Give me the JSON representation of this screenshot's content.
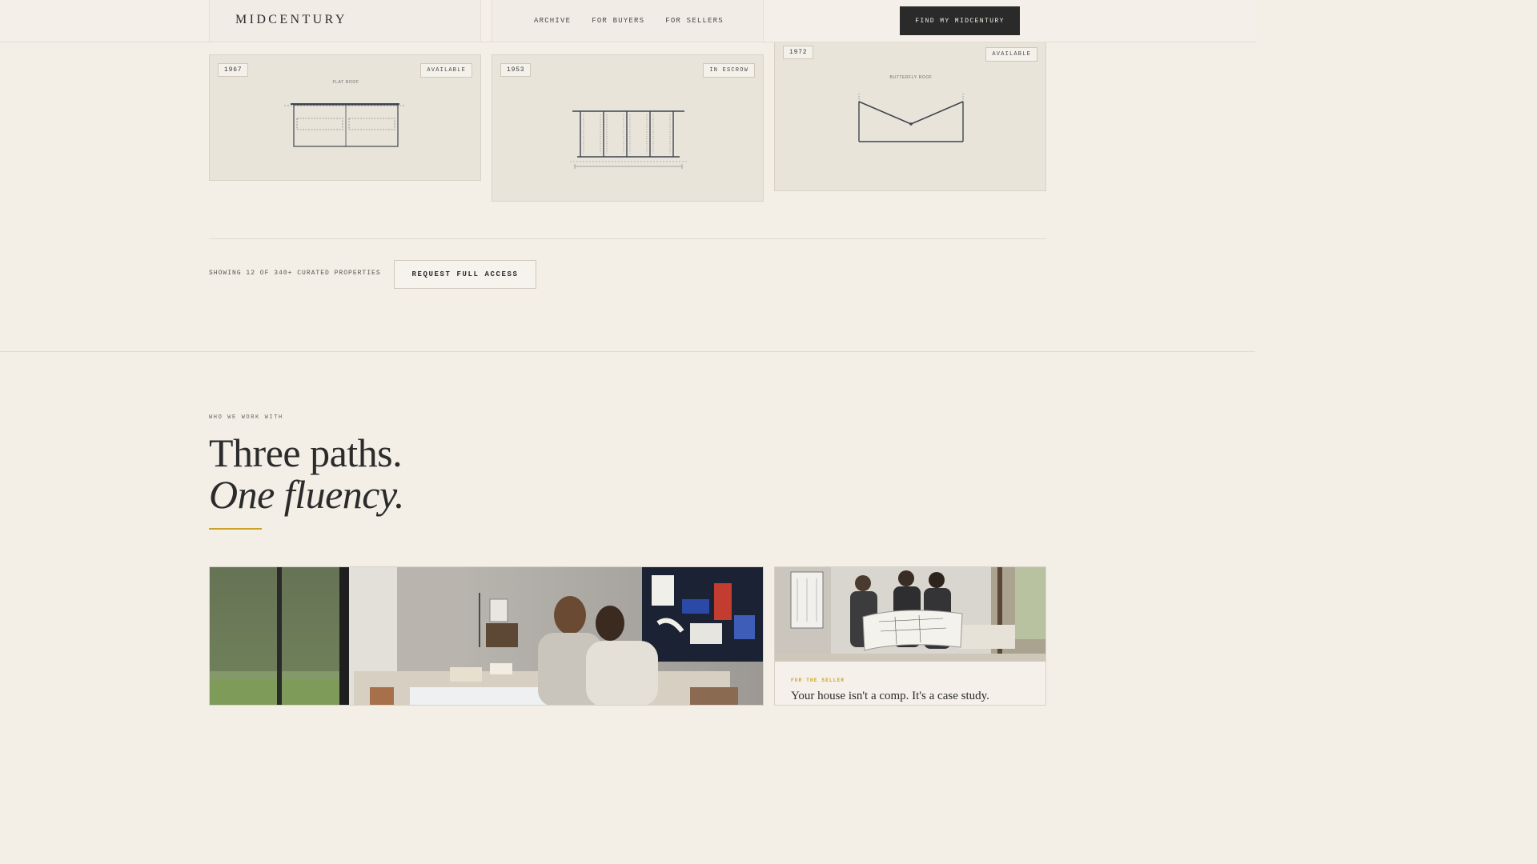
{
  "header": {
    "logo": "MIDCENTURY",
    "nav": [
      "ARCHIVE",
      "FOR BUYERS",
      "FOR SELLERS"
    ],
    "cta": "FIND MY MIDCENTURY"
  },
  "properties": [
    {
      "year": "1967",
      "status": "AVAILABLE",
      "roof": "FLAT ROOF"
    },
    {
      "year": "1953",
      "status": "IN ESCROW",
      "roof": ""
    },
    {
      "year": "1972",
      "status": "AVAILABLE",
      "roof": "BUTTERFLY ROOF"
    }
  ],
  "listing": {
    "showing": "SHOWING 12 OF 340+ CURATED PROPERTIES",
    "access_button": "REQUEST FULL ACCESS"
  },
  "section": {
    "eyebrow": "WHO WE WORK WITH",
    "headline_1": "Three paths.",
    "headline_2": "One fluency.",
    "accent_color": "#c9a227"
  },
  "seller_card": {
    "eyebrow": "FOR THE SELLER",
    "title": "Your house isn't a comp. It's a case study."
  },
  "icons": [
    "flat-roof-drawing",
    "post-and-beam-drawing",
    "butterfly-roof-drawing"
  ]
}
